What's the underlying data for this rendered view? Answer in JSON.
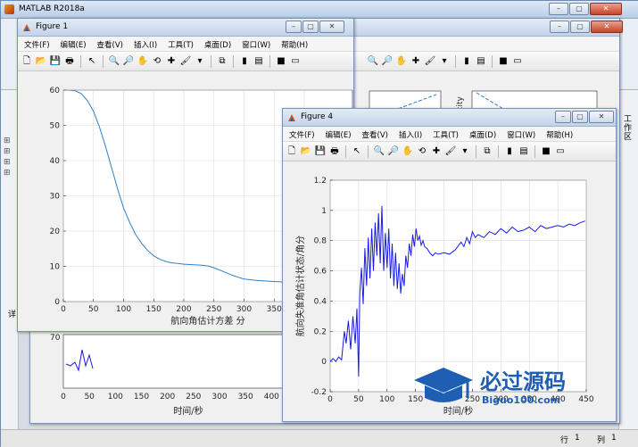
{
  "main_window": {
    "title": "MATLAB R2018a",
    "status_row_label": "行",
    "status_row_value": "1",
    "status_col_label": "列",
    "status_col_value": "1"
  },
  "figure1": {
    "title": "Figure 1",
    "menu": [
      "文件(F)",
      "编辑(E)",
      "查看(V)",
      "插入(I)",
      "工具(T)",
      "桌面(D)",
      "窗口(W)",
      "帮助(H)"
    ],
    "chart_data": {
      "type": "line",
      "xlabel": "航向角估计方差 分",
      "ylabel": "",
      "xlim": [
        0,
        480
      ],
      "ylim": [
        0,
        60
      ],
      "xticks": [
        0,
        50,
        100,
        150,
        200,
        250,
        300,
        350,
        400
      ],
      "yticks": [
        0,
        10,
        20,
        30,
        40,
        50,
        60
      ],
      "grid": true,
      "series": [
        {
          "color": "#2f7fc1",
          "x": [
            0,
            10,
            20,
            30,
            40,
            50,
            60,
            70,
            80,
            90,
            100,
            110,
            120,
            130,
            140,
            150,
            160,
            170,
            180,
            190,
            200,
            210,
            220,
            230,
            240,
            250,
            260,
            270,
            280,
            290,
            300,
            320,
            340,
            360,
            380,
            400,
            420,
            440,
            460,
            480
          ],
          "y": [
            60,
            60,
            59.8,
            59,
            57,
            54,
            49.5,
            44,
            38,
            32,
            26.5,
            22.5,
            19,
            16.5,
            14.5,
            13,
            12,
            11.4,
            11,
            10.8,
            10.6,
            10.5,
            10.4,
            10.3,
            10.1,
            9.6,
            8.9,
            8.2,
            7.5,
            6.9,
            6.4,
            6.0,
            5.8,
            5.6,
            5.2,
            4.7,
            4.1,
            3.6,
            3.3,
            3.0
          ]
        }
      ]
    }
  },
  "figure4": {
    "title": "Figure 4",
    "menu": [
      "文件(F)",
      "编辑(E)",
      "查看(V)",
      "插入(I)",
      "工具(T)",
      "桌面(D)",
      "窗口(W)",
      "帮助(H)"
    ],
    "chart_data": {
      "type": "line",
      "xlabel": "时间/秒",
      "ylabel": "航向失准角估计状态/角分",
      "xlim": [
        0,
        450
      ],
      "ylim": [
        -0.2,
        1.2
      ],
      "xticks": [
        0,
        50,
        100,
        150,
        200,
        250,
        300,
        350,
        400,
        450
      ],
      "yticks": [
        -0.2,
        0,
        0.2,
        0.4,
        0.6,
        0.8,
        1,
        1.2
      ],
      "grid": true,
      "series": [
        {
          "color": "#1a1ae6",
          "x": [
            0,
            5,
            10,
            15,
            20,
            25,
            28,
            32,
            36,
            40,
            44,
            47,
            50,
            52,
            55,
            58,
            61,
            64,
            67,
            70,
            73,
            76,
            79,
            82,
            85,
            88,
            91,
            94,
            97,
            100,
            103,
            106,
            109,
            112,
            115,
            118,
            121,
            124,
            127,
            130,
            133,
            136,
            139,
            142,
            145,
            148,
            151,
            154,
            157,
            160,
            163,
            166,
            170,
            175,
            180,
            185,
            190,
            200,
            210,
            220,
            230,
            235,
            240,
            245,
            250,
            255,
            260,
            270,
            280,
            290,
            300,
            310,
            320,
            330,
            340,
            350,
            360,
            370,
            380,
            390,
            400,
            410,
            420,
            430,
            440,
            448
          ],
          "y": [
            0,
            0.02,
            0,
            0.03,
            0.01,
            0.2,
            0.12,
            0.27,
            0.08,
            0.3,
            0.12,
            0.35,
            -0.1,
            0.45,
            0.62,
            0.38,
            0.75,
            0.5,
            0.82,
            0.55,
            0.88,
            0.6,
            0.92,
            0.7,
            0.98,
            0.65,
            1.03,
            0.6,
            0.85,
            0.62,
            0.88,
            0.55,
            0.78,
            0.5,
            0.72,
            0.48,
            0.65,
            0.45,
            0.58,
            0.5,
            0.7,
            0.62,
            0.78,
            0.7,
            0.84,
            0.76,
            0.88,
            0.8,
            0.83,
            0.77,
            0.8,
            0.76,
            0.75,
            0.72,
            0.7,
            0.72,
            0.71,
            0.72,
            0.71,
            0.74,
            0.79,
            0.76,
            0.82,
            0.78,
            0.86,
            0.82,
            0.84,
            0.82,
            0.86,
            0.84,
            0.88,
            0.85,
            0.89,
            0.86,
            0.87,
            0.89,
            0.86,
            0.9,
            0.88,
            0.89,
            0.9,
            0.89,
            0.91,
            0.9,
            0.92,
            0.93
          ]
        }
      ]
    }
  },
  "background_figure": {
    "lower_xlabel": "时间/秒",
    "lower_xticks": [
      0,
      50,
      100,
      150,
      200,
      250,
      300,
      350,
      400
    ],
    "lower_ytick": "70",
    "velocity_label": "elocity",
    "menu": [
      "文件(F)",
      "编辑(E)",
      "查看(V)",
      "插入(I)",
      "工具(T)",
      "桌面(D)",
      "窗口(W)",
      "帮助(H)"
    ]
  },
  "side_labels": {
    "tab_gongzuo": "工作区",
    "left_tab": "详"
  },
  "watermark": {
    "brand": "必过源码",
    "url": "Biguo100.com",
    "brand_color": "#1e5fb4"
  },
  "colors": {
    "figure1_line": "#2f7fc1",
    "figure4_line": "#1a1ae6"
  }
}
